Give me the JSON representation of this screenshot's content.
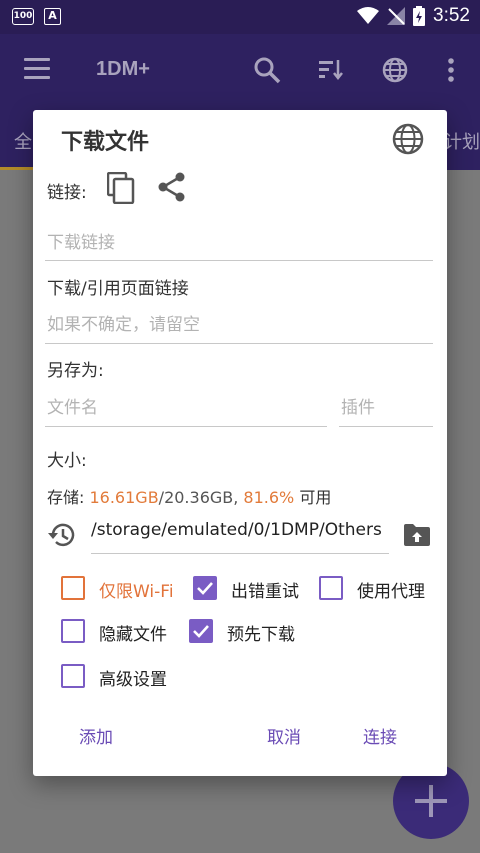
{
  "status_bar": {
    "left_icons": [
      "100",
      "A"
    ],
    "time": "3:52"
  },
  "app_bar": {
    "title": "1DM+",
    "icons": [
      "menu-icon",
      "search-icon",
      "sort-icon",
      "globe-icon",
      "more-vert-icon"
    ]
  },
  "tabs": {
    "left_partial": "全",
    "right_partial": "计划"
  },
  "dialog": {
    "title": "下载文件",
    "link_label": "链接:",
    "link_placeholder": "下载链接",
    "ref_label": "下载/引用页面链接",
    "ref_placeholder": "如果不确定，请留空",
    "save_as_label": "另存为:",
    "filename_placeholder": "文件名",
    "plugin_placeholder": "插件",
    "size_label": "大小:",
    "storage": {
      "prefix": "存储: ",
      "used": "16.61GB",
      "separator": "/20.36GB, ",
      "percent": "81.6%",
      "suffix": " 可用"
    },
    "path": "/storage/emulated/0/1DMP/Others",
    "options": {
      "wifi_only": {
        "label": "仅限Wi-Fi",
        "checked": false
      },
      "retry_on_error": {
        "label": "出错重试",
        "checked": true
      },
      "use_proxy": {
        "label": "使用代理",
        "checked": false
      },
      "hidden_file": {
        "label": "隐藏文件",
        "checked": false
      },
      "pre_download": {
        "label": "预先下载",
        "checked": true
      },
      "advanced": {
        "label": "高级设置",
        "checked": false
      }
    },
    "buttons": {
      "add": "添加",
      "cancel": "取消",
      "connect": "连接"
    }
  },
  "colors": {
    "accent": "#7a5cc4",
    "orange": "#e2733a",
    "button_text": "#6a4bb5"
  }
}
